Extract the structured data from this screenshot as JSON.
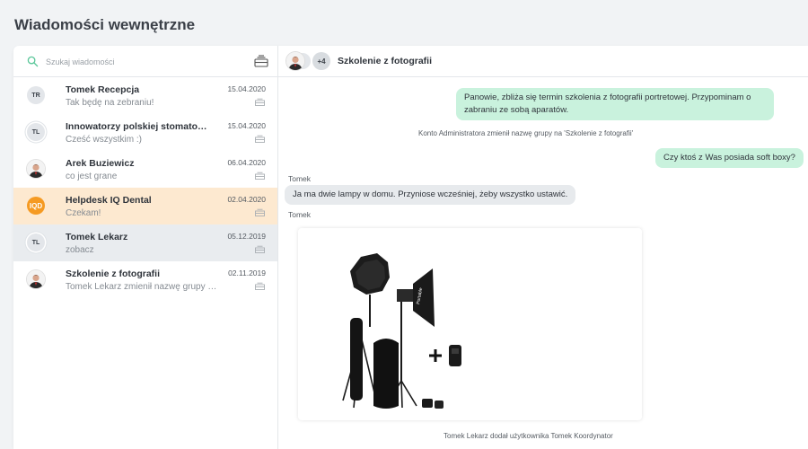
{
  "page": {
    "title": "Wiadomości wewnętrzne"
  },
  "search": {
    "placeholder": "Szukaj wiadomości"
  },
  "icons": {
    "search": "search-icon",
    "compose": "inbox-tray-icon",
    "archive": "archive-box-icon"
  },
  "colors": {
    "accent_orange": "#f59a22",
    "active_row": "#fde9d0",
    "selected_row": "#e9ecef",
    "outgoing_bubble": "#c9f2dd",
    "incoming_bubble": "#e7eaed"
  },
  "conversations": [
    {
      "initials": "TR",
      "name": "Tomek Recepcja",
      "preview": "Tak będę na zebraniu!",
      "date": "15.04.2020"
    },
    {
      "initials": "TL",
      "name": "Innowatorzy polskiej stomatologii",
      "preview": "Cześć wszystkim :)",
      "date": "15.04.2020"
    },
    {
      "initials": "",
      "name": "Arek Buziewicz",
      "preview": "co jest grane",
      "date": "06.04.2020"
    },
    {
      "initials": "IQD",
      "name": "Helpdesk IQ Dental",
      "preview": "Czekam!",
      "date": "02.04.2020"
    },
    {
      "initials": "TL",
      "name": "Tomek Lekarz",
      "preview": "zobacz",
      "date": "05.12.2019"
    },
    {
      "initials": "",
      "name": "Szkolenie z fotografii",
      "preview": "Tomek Lekarz zmienił nazwę grupy na 'Szkolenie z fotografii'",
      "date": "02.11.2019"
    }
  ],
  "chat": {
    "title": "Szkolenie z fotografii",
    "extra_members": "+4",
    "messages": [
      {
        "text": "Panowie, zbliża się termin szkolenia z fotografii portretowej. Przypominam o zabraniu ze sobą aparatów."
      },
      {
        "text": "Konto Administratora zmienił nazwę grupy na 'Szkolenie z fotografii'"
      },
      {
        "text": "Czy ktoś z Was posiada soft boxy?"
      },
      {
        "sender": "Tomek",
        "text": "Ja ma dwie lampy w domu. Przyniose wcześniej, żeby wszystko ustawić."
      },
      {
        "sender": "Tomek"
      },
      {
        "text": "Tomek Lekarz dodał użytkownika Tomek Koordynator"
      }
    ],
    "photo_brand": "Portable"
  }
}
